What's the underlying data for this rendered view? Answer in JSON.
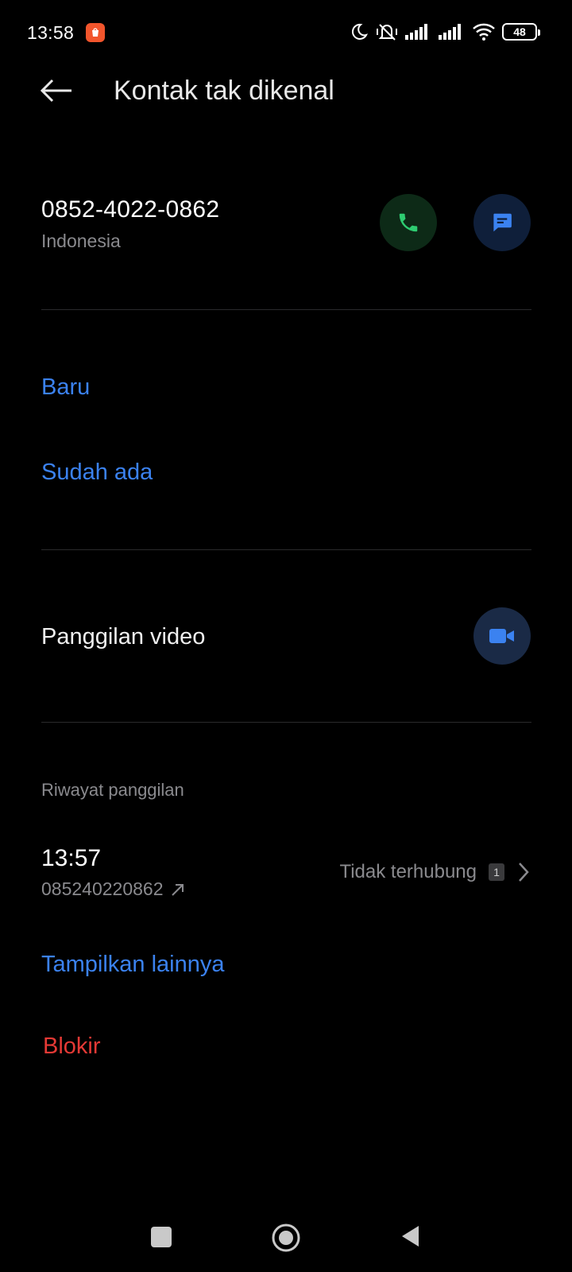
{
  "status_bar": {
    "time": "13:58",
    "battery": "48",
    "icons": [
      "shopee-notification-icon",
      "moon-icon",
      "mute-vibrate-icon",
      "signal-icon",
      "signal-icon",
      "wifi-icon",
      "battery-icon"
    ]
  },
  "header": {
    "title": "Kontak tak dikenal",
    "back_icon": "arrow-left-icon"
  },
  "contact": {
    "number": "0852-4022-0862",
    "country": "Indonesia",
    "call_icon": "phone-icon",
    "message_icon": "message-icon"
  },
  "add_contact": {
    "new_label": "Baru",
    "existing_label": "Sudah ada"
  },
  "video": {
    "label": "Panggilan video",
    "icon": "video-camera-icon"
  },
  "call_history": {
    "section_label": "Riwayat panggilan",
    "entries": [
      {
        "time": "13:57",
        "number": "085240220862",
        "status": "Tidak terhubung",
        "sim": "1",
        "direction_icon": "outgoing-arrow-icon"
      }
    ],
    "show_more_label": "Tampilkan lainnya"
  },
  "block_label": "Blokir",
  "colors": {
    "background": "#000000",
    "accent_blue": "#3b82f0",
    "danger_red": "#e53935",
    "call_green": "#2ecc71",
    "secondary_text": "#8a8a8e"
  }
}
